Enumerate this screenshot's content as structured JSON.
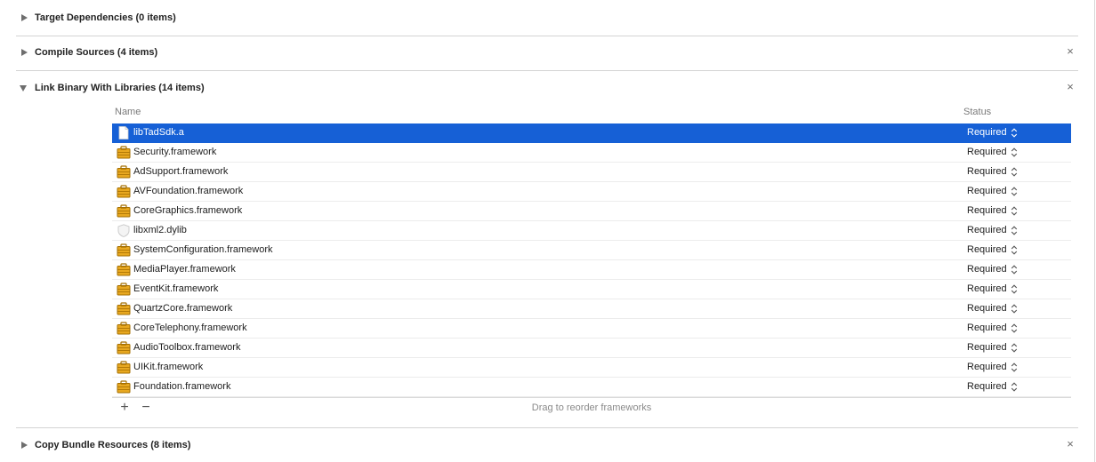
{
  "sections": {
    "target_dependencies": {
      "title": "Target Dependencies (0 items)"
    },
    "compile_sources": {
      "title": "Compile Sources (4 items)",
      "remove_icon": "×"
    },
    "link_binary": {
      "title": "Link Binary With Libraries (14 items)",
      "remove_icon": "×"
    },
    "copy_bundle": {
      "title": "Copy Bundle Resources (8 items)",
      "remove_icon": "×"
    }
  },
  "table": {
    "name_header": "Name",
    "status_header": "Status",
    "rows": [
      {
        "name": "libTadSdk.a",
        "status": "Required",
        "icon": "file-icon",
        "selected": true
      },
      {
        "name": "Security.framework",
        "status": "Required",
        "icon": "framework-icon"
      },
      {
        "name": "AdSupport.framework",
        "status": "Required",
        "icon": "framework-icon"
      },
      {
        "name": "AVFoundation.framework",
        "status": "Required",
        "icon": "framework-icon"
      },
      {
        "name": "CoreGraphics.framework",
        "status": "Required",
        "icon": "framework-icon"
      },
      {
        "name": "libxml2.dylib",
        "status": "Required",
        "icon": "library-icon"
      },
      {
        "name": "SystemConfiguration.framework",
        "status": "Required",
        "icon": "framework-icon"
      },
      {
        "name": "MediaPlayer.framework",
        "status": "Required",
        "icon": "framework-icon"
      },
      {
        "name": "EventKit.framework",
        "status": "Required",
        "icon": "framework-icon"
      },
      {
        "name": "QuartzCore.framework",
        "status": "Required",
        "icon": "framework-icon"
      },
      {
        "name": "CoreTelephony.framework",
        "status": "Required",
        "icon": "framework-icon"
      },
      {
        "name": "AudioToolbox.framework",
        "status": "Required",
        "icon": "framework-icon"
      },
      {
        "name": "UIKit.framework",
        "status": "Required",
        "icon": "framework-icon"
      },
      {
        "name": "Foundation.framework",
        "status": "Required",
        "icon": "framework-icon"
      }
    ],
    "add_label": "+",
    "remove_label": "−",
    "hint": "Drag to reorder frameworks"
  },
  "colors": {
    "selection": "#1660d6",
    "framework_icon": "#e8a820"
  }
}
